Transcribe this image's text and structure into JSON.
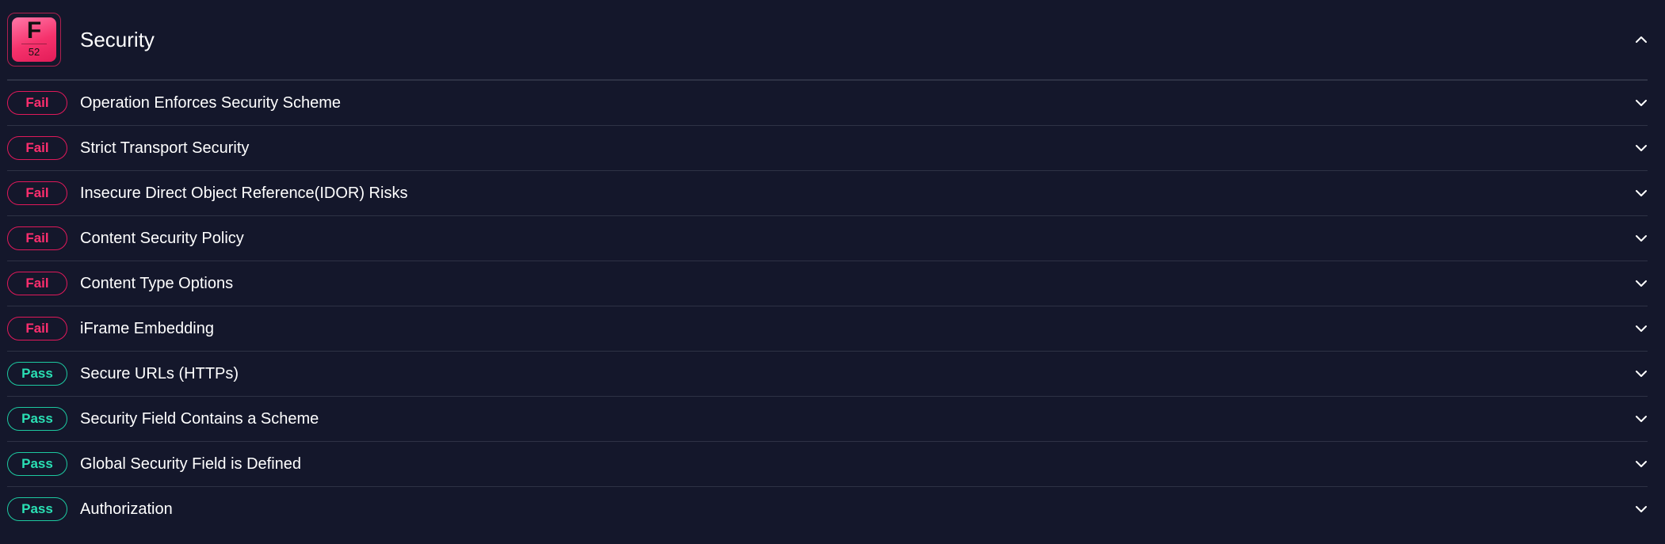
{
  "section": {
    "title": "Security",
    "grade": {
      "letter": "F",
      "score": "52"
    },
    "expanded": true
  },
  "colors": {
    "background": "#14172b",
    "fail": "#ff2e6e",
    "pass": "#2ae0b4",
    "grade_gradient_start": "#ff78a8",
    "grade_gradient_end": "#e31c58"
  },
  "checks": [
    {
      "status": "fail",
      "badge": "Fail",
      "label": "Operation Enforces Security Scheme"
    },
    {
      "status": "fail",
      "badge": "Fail",
      "label": "Strict Transport Security"
    },
    {
      "status": "fail",
      "badge": "Fail",
      "label": "Insecure Direct Object Reference(IDOR) Risks"
    },
    {
      "status": "fail",
      "badge": "Fail",
      "label": "Content Security Policy"
    },
    {
      "status": "fail",
      "badge": "Fail",
      "label": "Content Type Options"
    },
    {
      "status": "fail",
      "badge": "Fail",
      "label": "iFrame Embedding"
    },
    {
      "status": "pass",
      "badge": "Pass",
      "label": "Secure URLs (HTTPs)"
    },
    {
      "status": "pass",
      "badge": "Pass",
      "label": "Security Field Contains a Scheme"
    },
    {
      "status": "pass",
      "badge": "Pass",
      "label": "Global Security Field is Defined"
    },
    {
      "status": "pass",
      "badge": "Pass",
      "label": "Authorization"
    }
  ]
}
